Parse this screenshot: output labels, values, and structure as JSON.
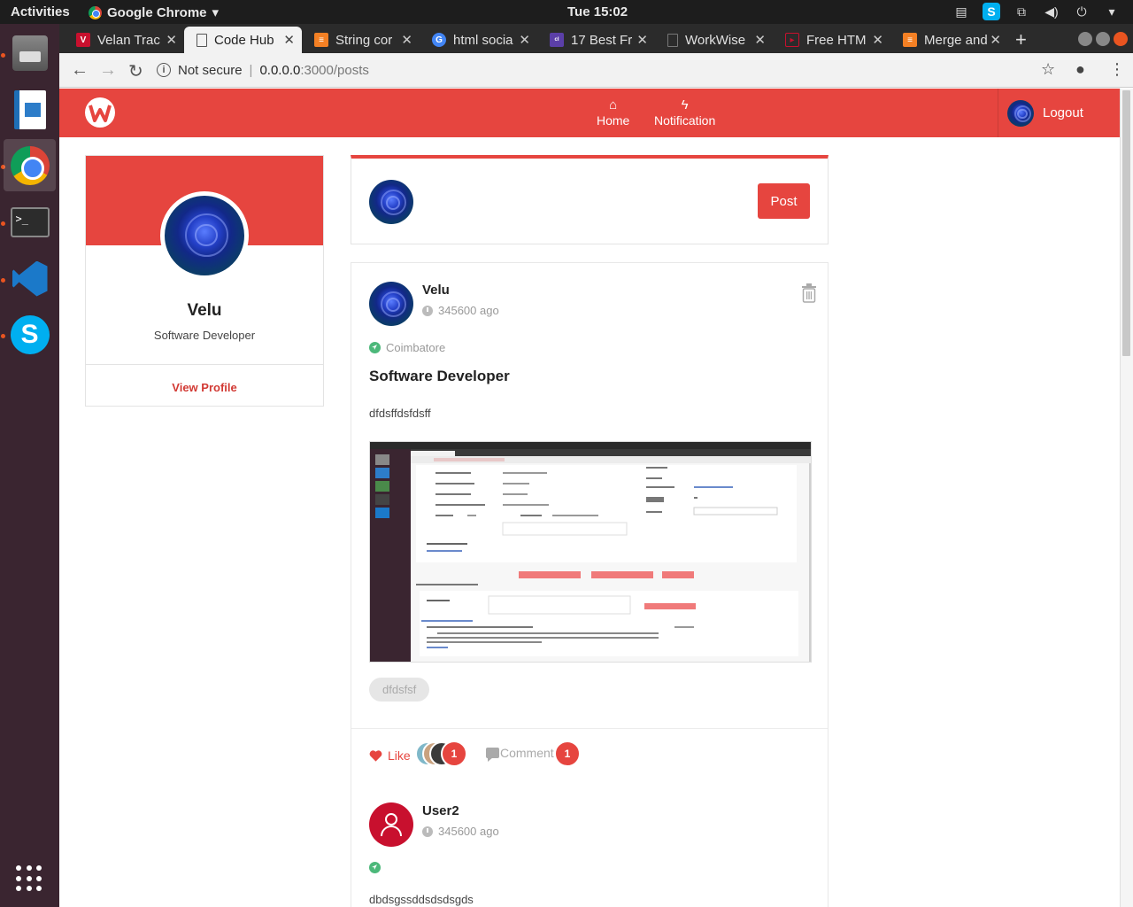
{
  "system": {
    "activities": "Activities",
    "app_menu": "Google Chrome",
    "clock": "Tue 15:02"
  },
  "tabs": [
    {
      "label": "Velan Trac",
      "favicon_color": "#c8102e"
    },
    {
      "label": "Code Hub",
      "favicon_color": "#666666",
      "active": true
    },
    {
      "label": "String cor",
      "favicon_color": "#f48024"
    },
    {
      "label": "html socia",
      "favicon_color": "#4285f4"
    },
    {
      "label": "17 Best Fr",
      "favicon_color": "#5b3fa8"
    },
    {
      "label": "WorkWise",
      "favicon_color": "#888888"
    },
    {
      "label": "Free HTM",
      "favicon_color": "#c8102e"
    },
    {
      "label": "Merge and",
      "favicon_color": "#f48024"
    }
  ],
  "address": {
    "security": "Not secure",
    "host": "0.0.0.0",
    "path": ":3000/posts"
  },
  "nav": {
    "home": "Home",
    "notification": "Notification",
    "logout": "Logout"
  },
  "profile": {
    "name": "Velu",
    "role": "Software Developer",
    "view_profile": "View Profile"
  },
  "composer": {
    "post_button": "Post"
  },
  "post": {
    "author": "Velu",
    "time": "345600 ago",
    "location": "Coimbatore",
    "title": "Software Developer",
    "body": "dfdsffdsfdsff",
    "tag": "dfdsfsf",
    "like_label": "Like",
    "like_count": "1",
    "comment_label": "Comment",
    "comment_count": "1"
  },
  "comment": {
    "author": "User2",
    "time": "345600 ago",
    "body": "dbdsgssddsdsdsgds"
  },
  "colors": {
    "brand": "#e6453f",
    "location_icon": "#4cb87a"
  }
}
